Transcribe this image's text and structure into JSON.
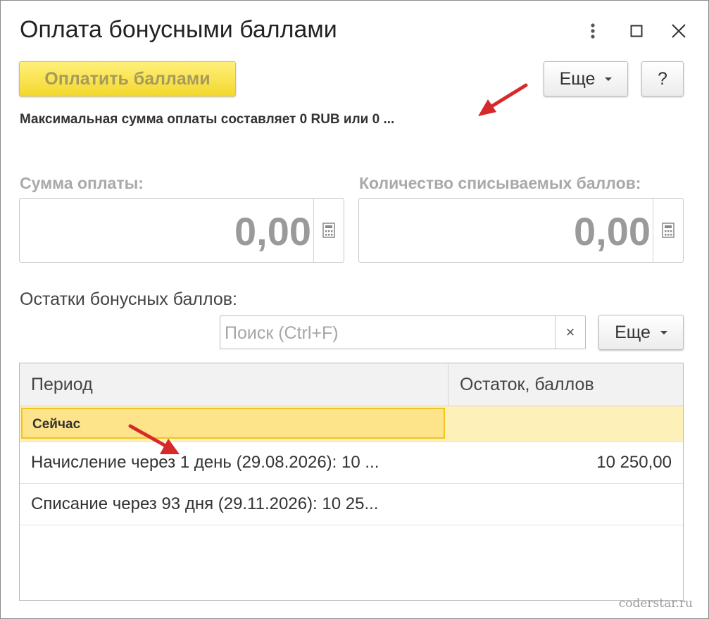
{
  "window": {
    "title": "Оплата бонусными баллами"
  },
  "toolbar": {
    "pay_label": "Оплатить баллами",
    "more_label": "Еще",
    "help_label": "?"
  },
  "info_text": "Максимальная сумма оплаты составляет 0 RUB или 0 ...",
  "fields": {
    "sum": {
      "label": "Сумма оплаты:",
      "value": "0,00"
    },
    "points": {
      "label": "Количество списываемых баллов:",
      "value": "0,00"
    }
  },
  "balances": {
    "heading": "Остатки бонусных баллов:",
    "search_placeholder": "Поиск (Ctrl+F)",
    "clear_label": "×",
    "more_label": "Еще",
    "columns": [
      "Период",
      "Остаток, баллов"
    ],
    "group_label": "Сейчас",
    "rows": [
      {
        "period": "Начисление через 1 день (29.08.2026): 10 ...",
        "balance": "10 250,00"
      },
      {
        "period": "Списание через 93 дня (29.11.2026): 10 25...",
        "balance": ""
      }
    ]
  },
  "watermark": "coderstar.ru",
  "colors": {
    "accent_yellow": "#f3d82d",
    "selection_border": "#f0c322",
    "annotation_arrow": "#d62a2a"
  }
}
